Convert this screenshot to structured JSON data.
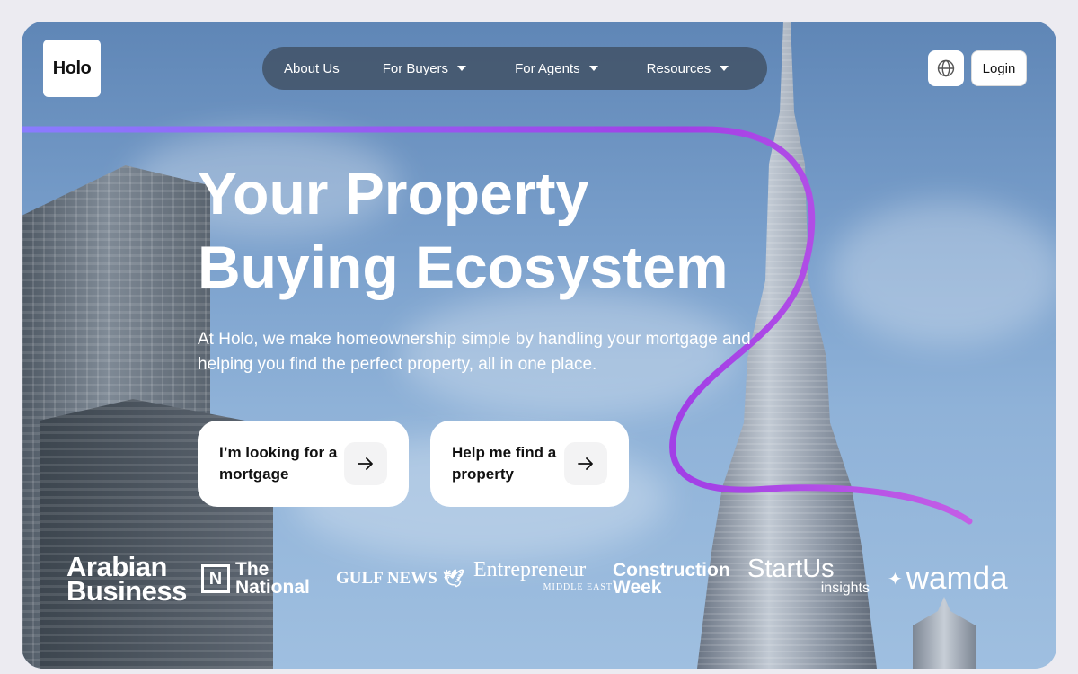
{
  "brand": {
    "logo_text": "Holo"
  },
  "nav": {
    "items": [
      {
        "label": "About Us",
        "has_dropdown": false
      },
      {
        "label": "For Buyers",
        "has_dropdown": true
      },
      {
        "label": "For Agents",
        "has_dropdown": true
      },
      {
        "label": "Resources",
        "has_dropdown": true
      }
    ]
  },
  "header": {
    "language_icon": "globe-icon",
    "login_label": "Login"
  },
  "hero": {
    "title_line1": "Your Property",
    "title_line2": "Buying Ecosystem",
    "subtitle": "At Holo, we make homeownership simple by handling your mortgage and helping you find the perfect property, all in one place.",
    "cta_mortgage_label": "I’m looking for a mortgage",
    "cta_property_label": "Help me find a property",
    "cta_icon": "arrow-right-icon"
  },
  "press": {
    "arabian_business_1": "Arabian",
    "arabian_business_2": "Business",
    "the_national_1": "The",
    "the_national_2": "National",
    "gulf_news": "GULF NEWS",
    "entrepreneur": "Entrepreneur",
    "entrepreneur_sub": "MIDDLE EAST",
    "construction_1": "Construction",
    "construction_2": "Week",
    "startus": "StartUs",
    "startus_sub": "insights",
    "wamda": "wamda"
  },
  "colors": {
    "accent_gradient_start": "#8a7cff",
    "accent_gradient_end": "#b04fe0",
    "nav_bg": "#3c4858"
  }
}
